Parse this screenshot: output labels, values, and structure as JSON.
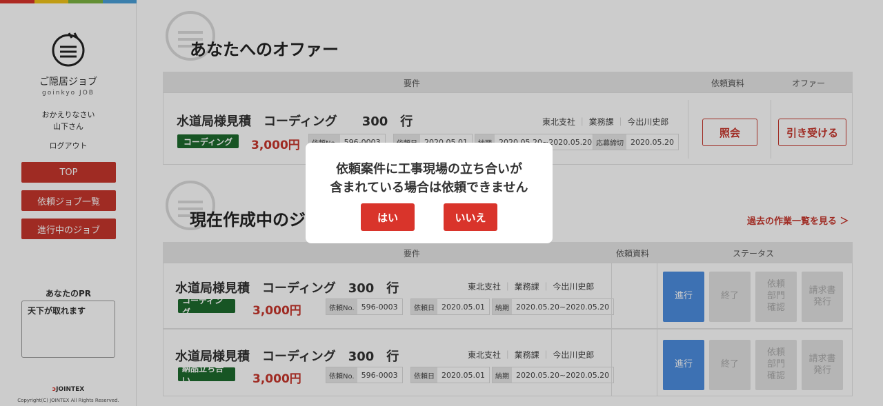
{
  "sidebar": {
    "brand_name": "ご隠居ジョブ",
    "brand_sub": "goinkyo JOB",
    "greeting": "おかえりなさい",
    "username": "山下さん",
    "logout": "ログアウト",
    "nav": [
      "TOP",
      "依頼ジョブ一覧",
      "進行中のジョブ"
    ],
    "pr_title": "あなたのPR",
    "pr_text": "天下が取れます",
    "footer_logo": "JOINTEX",
    "copyright": "Copyright(C) JOINTEX All Rights Reserved."
  },
  "offers": {
    "title": "あなたへのオファー",
    "col_requirements": "要件",
    "col_docs": "依頼資料",
    "col_offer": "オファー",
    "job": {
      "title": "水道局様見積　コーディング　　300　行",
      "branch": "東北支社",
      "dept": "業務課",
      "person": "今出川史郎",
      "tag": "コーディング",
      "price": "3,000円",
      "no_label": "依頼No.",
      "no_value": "596-0003",
      "date_label": "依頼日",
      "date_value": "2020.05.01",
      "due_label": "納期",
      "due_value": "2020.05.20~2020.05.20",
      "deadline_label": "応募締切",
      "deadline_value": "2020.05.20"
    },
    "btn_view": "照会",
    "btn_accept": "引き受ける"
  },
  "current": {
    "title": "現在作成中のジョブ",
    "history_link": "過去の作業一覧を見る ＞",
    "col_requirements": "要件",
    "col_docs": "依頼資料",
    "col_status": "ステータス",
    "jobs": [
      {
        "title": "水道局様見積　コーディング　300　行",
        "branch": "東北支社",
        "dept": "業務課",
        "person": "今出川史郎",
        "tag": "コーディング",
        "price": "3,000円",
        "no_label": "依頼No.",
        "no_value": "596-0003",
        "date_label": "依頼日",
        "date_value": "2020.05.01",
        "due_label": "納期",
        "due_value": "2020.05.20~2020.05.20"
      },
      {
        "title": "水道局様見積　コーディング　300　行",
        "branch": "東北支社",
        "dept": "業務課",
        "person": "今出川史郎",
        "tag": "納品立ち合い",
        "price": "3,000円",
        "no_label": "依頼No.",
        "no_value": "596-0003",
        "date_label": "依頼日",
        "date_value": "2020.05.01",
        "due_label": "納期",
        "due_value": "2020.05.20~2020.05.20"
      }
    ],
    "status_labels": [
      "進行",
      "終了",
      "依頼\n部門\n確認",
      "請求書\n発行"
    ]
  },
  "dialog": {
    "line1": "依頼案件に工事現場の立ち合いが",
    "line2": "含まれている場合は依頼できません",
    "yes": "はい",
    "no": "いいえ"
  },
  "colors": {
    "accent_red": "#c7362c",
    "tag_green": "#1d6b2e",
    "status_blue": "#4d8ee0",
    "top_stripe": [
      "#d9342b",
      "#f0c419",
      "#7cb342",
      "#4a9fd8"
    ]
  }
}
